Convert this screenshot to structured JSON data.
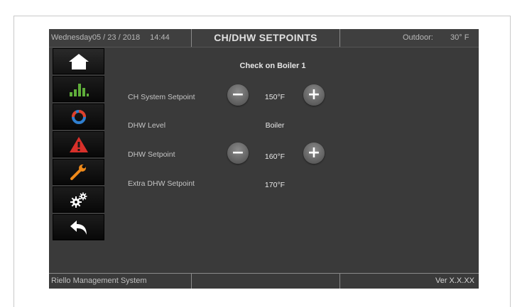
{
  "header": {
    "day": "Wednesday",
    "date": "05 / 23 / 2018",
    "time": "14:44",
    "title": "CH/DHW SETPOINTS",
    "outdoor_label": "Outdoor:",
    "outdoor_value": "30° F"
  },
  "sidebar": {
    "items": [
      {
        "name": "home",
        "icon": "home-icon"
      },
      {
        "name": "statistics",
        "icon": "bar-chart-icon"
      },
      {
        "name": "cycle",
        "icon": "refresh-ring-icon"
      },
      {
        "name": "alarms",
        "icon": "warning-icon"
      },
      {
        "name": "service",
        "icon": "wrench-icon"
      },
      {
        "name": "settings",
        "icon": "gears-icon"
      },
      {
        "name": "back",
        "icon": "back-arrow-icon"
      }
    ]
  },
  "main": {
    "heading": "Check on Boiler 1",
    "rows": [
      {
        "label": "CH System Setpoint",
        "value": "150°F",
        "adjustable": true
      },
      {
        "label": "DHW Level",
        "value": "Boiler",
        "adjustable": false
      },
      {
        "label": "DHW Setpoint",
        "value": "160°F",
        "adjustable": true
      },
      {
        "label": "Extra DHW Setpoint",
        "value": "170°F",
        "adjustable": false
      }
    ],
    "minus_glyph": "−",
    "plus_glyph": "+"
  },
  "footer": {
    "system_name": "Riello Management System",
    "middle": "",
    "version": "Ver X.X.XX"
  },
  "colors": {
    "screen_bg": "#3a3a3a",
    "button_bg": "#0f0f0f",
    "accent_white": "#ffffff"
  }
}
